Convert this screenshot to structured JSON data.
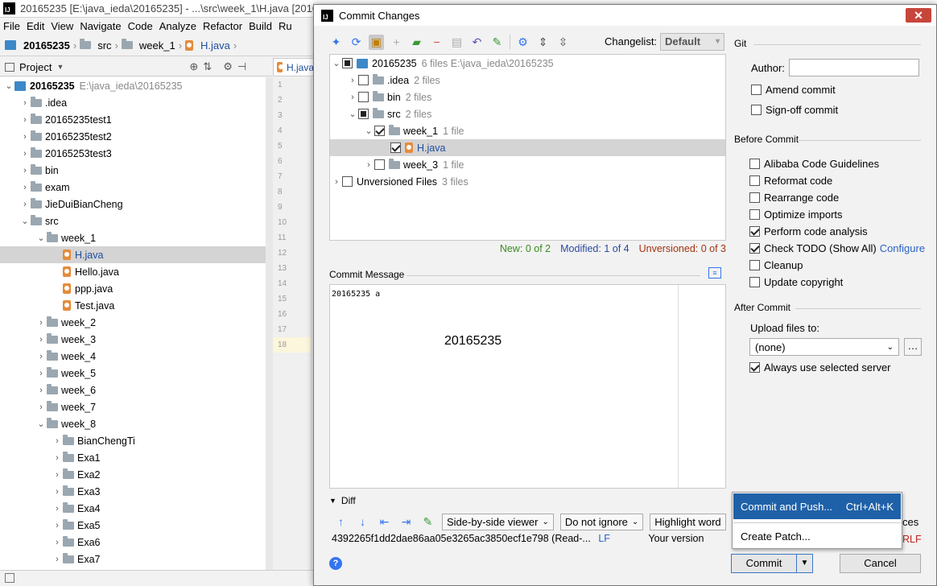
{
  "ide": {
    "title": "20165235 [E:\\java_ieda\\20165235] - ...\\src\\week_1\\H.java [2016",
    "menu": [
      "File",
      "Edit",
      "View",
      "Navigate",
      "Code",
      "Analyze",
      "Refactor",
      "Build",
      "Ru"
    ],
    "breadcrumb": [
      "20165235",
      "src",
      "week_1",
      "H.java"
    ],
    "project_label": "Project",
    "editor_tab": "H.java",
    "line_numbers": [
      "1",
      "2",
      "3",
      "4",
      "5",
      "6",
      "7",
      "8",
      "9",
      "10",
      "11",
      "12",
      "13",
      "14",
      "15",
      "16",
      "17",
      "18"
    ],
    "tree": [
      {
        "label": "20165235",
        "path": "E:\\java_ieda\\20165235",
        "level": 0,
        "expanded": true,
        "type": "module"
      },
      {
        "label": ".idea",
        "level": 1,
        "type": "folder"
      },
      {
        "label": "20165235test1",
        "level": 1,
        "type": "folder"
      },
      {
        "label": "20165235test2",
        "level": 1,
        "type": "folder"
      },
      {
        "label": "20165253test3",
        "level": 1,
        "type": "folder"
      },
      {
        "label": "bin",
        "level": 1,
        "type": "folder"
      },
      {
        "label": "exam",
        "level": 1,
        "type": "folder"
      },
      {
        "label": "JieDuiBianCheng",
        "level": 1,
        "type": "folder"
      },
      {
        "label": "src",
        "level": 1,
        "expanded": true,
        "type": "folder"
      },
      {
        "label": "week_1",
        "level": 2,
        "expanded": true,
        "type": "folder"
      },
      {
        "label": "H.java",
        "level": 3,
        "type": "java",
        "selected": true
      },
      {
        "label": "Hello.java",
        "level": 3,
        "type": "java"
      },
      {
        "label": "ppp.java",
        "level": 3,
        "type": "java"
      },
      {
        "label": "Test.java",
        "level": 3,
        "type": "java"
      },
      {
        "label": "week_2",
        "level": 2,
        "type": "folder"
      },
      {
        "label": "week_3",
        "level": 2,
        "type": "folder"
      },
      {
        "label": "week_4",
        "level": 2,
        "type": "folder"
      },
      {
        "label": "week_5",
        "level": 2,
        "type": "folder"
      },
      {
        "label": "week_6",
        "level": 2,
        "type": "folder"
      },
      {
        "label": "week_7",
        "level": 2,
        "type": "folder"
      },
      {
        "label": "week_8",
        "level": 2,
        "expanded": true,
        "type": "folder"
      },
      {
        "label": "BianChengTi",
        "level": 3,
        "type": "folder"
      },
      {
        "label": "Exa1",
        "level": 3,
        "type": "folder"
      },
      {
        "label": "Exa2",
        "level": 3,
        "type": "folder"
      },
      {
        "label": "Exa3",
        "level": 3,
        "type": "folder"
      },
      {
        "label": "Exa4",
        "level": 3,
        "type": "folder"
      },
      {
        "label": "Exa5",
        "level": 3,
        "type": "folder"
      },
      {
        "label": "Exa6",
        "level": 3,
        "type": "folder"
      },
      {
        "label": "Exa7",
        "level": 3,
        "type": "folder"
      }
    ]
  },
  "dialog": {
    "title": "Commit Changes",
    "changelist_label": "Changelist:",
    "changelist_value": "Default",
    "files": [
      {
        "label": "20165235",
        "info": "6 files  E:\\java_ieda\\20165235",
        "level": 0,
        "state": "partial",
        "expanded": true,
        "type": "module"
      },
      {
        "label": ".idea",
        "info": "2 files",
        "level": 1,
        "state": "none",
        "type": "folder"
      },
      {
        "label": "bin",
        "info": "2 files",
        "level": 1,
        "state": "none",
        "type": "folder"
      },
      {
        "label": "src",
        "info": "2 files",
        "level": 1,
        "state": "partial",
        "expanded": true,
        "type": "folder"
      },
      {
        "label": "week_1",
        "info": "1 file",
        "level": 2,
        "state": "checked",
        "expanded": true,
        "type": "folder"
      },
      {
        "label": "H.java",
        "info": "",
        "level": 3,
        "state": "checked",
        "type": "java",
        "selected": true
      },
      {
        "label": "week_3",
        "info": "1 file",
        "level": 2,
        "state": "none",
        "type": "folder"
      },
      {
        "label": "Unversioned Files",
        "info": "3 files",
        "level": 0,
        "state": "none",
        "type": "none"
      }
    ],
    "stats": {
      "new": "New: 0 of 2",
      "modified": "Modified: 1 of 4",
      "unversioned": "Unversioned: 0 of 3"
    },
    "commit_message_label": "Commit Message",
    "commit_message": "20165235 a",
    "commit_message_overlay": "20165235",
    "diff_label": "Diff",
    "viewer": "Side-by-side viewer",
    "ignore": "Do not ignore",
    "highlight": "Highlight word",
    "hash_line": "4392265f1dd2dae86aa05e3265ac3850ecf1e798 (Read-...",
    "lf": "LF",
    "your_version": "Your version",
    "crlf": "RLF",
    "spaces_suffix": "ces",
    "git_section": "Git",
    "author_label": "Author:",
    "author_value": "",
    "amend": "Amend commit",
    "signoff": "Sign-off commit",
    "before_commit": "Before Commit",
    "before_options": [
      {
        "label": "Alibaba Code Guidelines",
        "checked": false
      },
      {
        "label": "Reformat code",
        "checked": false
      },
      {
        "label": "Rearrange code",
        "checked": false
      },
      {
        "label": "Optimize imports",
        "checked": false
      },
      {
        "label": "Perform code analysis",
        "checked": true
      },
      {
        "label": "Check TODO (Show All)",
        "checked": true,
        "link": "Configure"
      },
      {
        "label": "Cleanup",
        "checked": false
      },
      {
        "label": "Update copyright",
        "checked": false
      }
    ],
    "after_commit": "After Commit",
    "upload_label": "Upload files to:",
    "upload_value": "(none)",
    "always_use": "Always use selected server",
    "popup": {
      "item1": "Commit and Push...",
      "shortcut": "Ctrl+Alt+K",
      "item2": "Create Patch..."
    },
    "commit_button": "Commit",
    "cancel_button": "Cancel",
    "help": "?"
  },
  "colors": {
    "new": "#3a8a1f",
    "modified": "#2b4a9c",
    "unversioned": "#a2330f",
    "link": "#2a63c5",
    "accent": "#1f61a8"
  }
}
